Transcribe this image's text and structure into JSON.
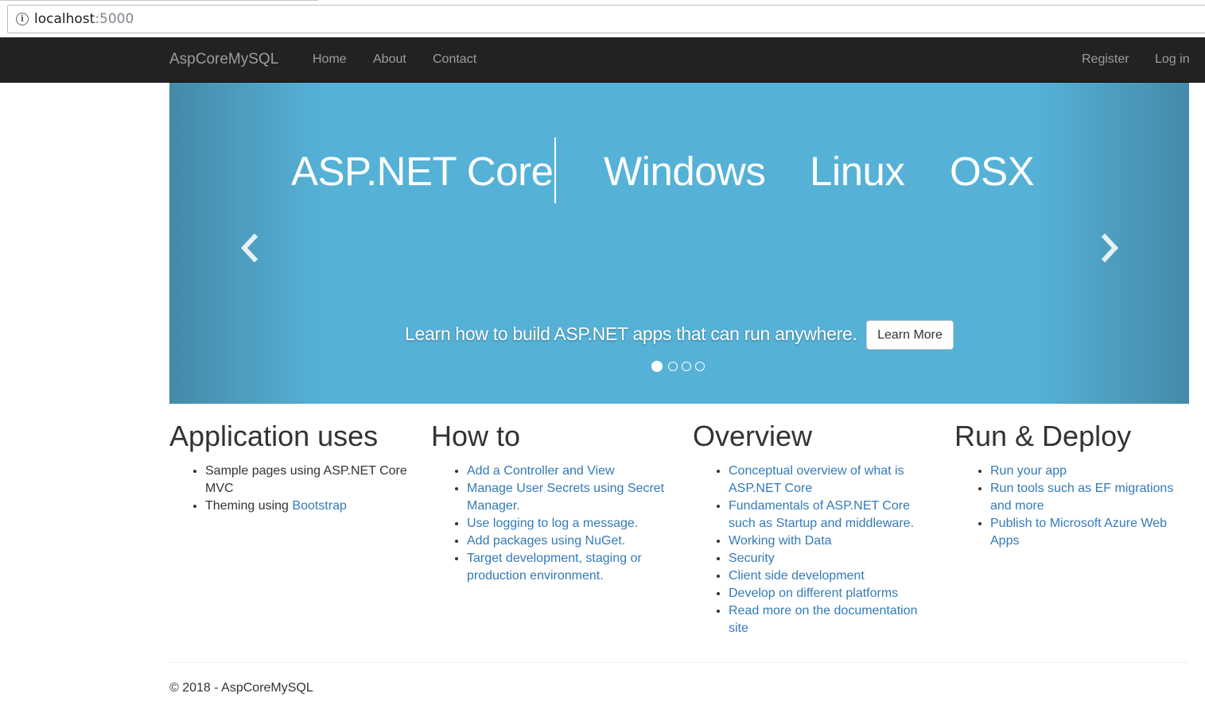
{
  "browser": {
    "url_host": "localhost",
    "url_port": ":5000",
    "info_icon": "info-icon"
  },
  "navbar": {
    "brand": "AspCoreMySQL",
    "items": [
      "Home",
      "About",
      "Contact"
    ],
    "right_items": [
      "Register",
      "Log in"
    ]
  },
  "carousel": {
    "headline_main": "ASP.NET Core",
    "headline_words": [
      "Windows",
      "Linux",
      "OSX"
    ],
    "caption": "Learn how to build ASP.NET apps that can run anywhere.",
    "button_label": "Learn More",
    "slide_count": 4,
    "active_slide": 1,
    "prev_icon": "chevron-left-icon",
    "next_icon": "chevron-right-icon",
    "background_color": "#56b1d7"
  },
  "columns": [
    {
      "title": "Application uses",
      "items": [
        {
          "text": "Sample pages using ASP.NET Core MVC"
        },
        {
          "text": "Theming using ",
          "link": "Bootstrap"
        }
      ]
    },
    {
      "title": "How to",
      "items": [
        {
          "link": "Add a Controller and View"
        },
        {
          "link": "Manage User Secrets using Secret Manager."
        },
        {
          "link": "Use logging to log a message."
        },
        {
          "link": "Add packages using NuGet."
        },
        {
          "link": "Target development, staging or production environment."
        }
      ]
    },
    {
      "title": "Overview",
      "items": [
        {
          "link": "Conceptual overview of what is ASP.NET Core"
        },
        {
          "link": "Fundamentals of ASP.NET Core such as Startup and middleware."
        },
        {
          "link": "Working with Data"
        },
        {
          "link": "Security"
        },
        {
          "link": "Client side development"
        },
        {
          "link": "Develop on different platforms"
        },
        {
          "link": "Read more on the documentation site"
        }
      ]
    },
    {
      "title": "Run & Deploy",
      "items": [
        {
          "link": "Run your app"
        },
        {
          "link": "Run tools such as EF migrations and more"
        },
        {
          "link": "Publish to Microsoft Azure Web Apps"
        }
      ]
    }
  ],
  "footer": {
    "text": "© 2018 - AspCoreMySQL"
  },
  "colors": {
    "navbar_bg": "#222222",
    "nav_text": "#9d9d9d",
    "link": "#337ab7",
    "text": "#333333"
  }
}
